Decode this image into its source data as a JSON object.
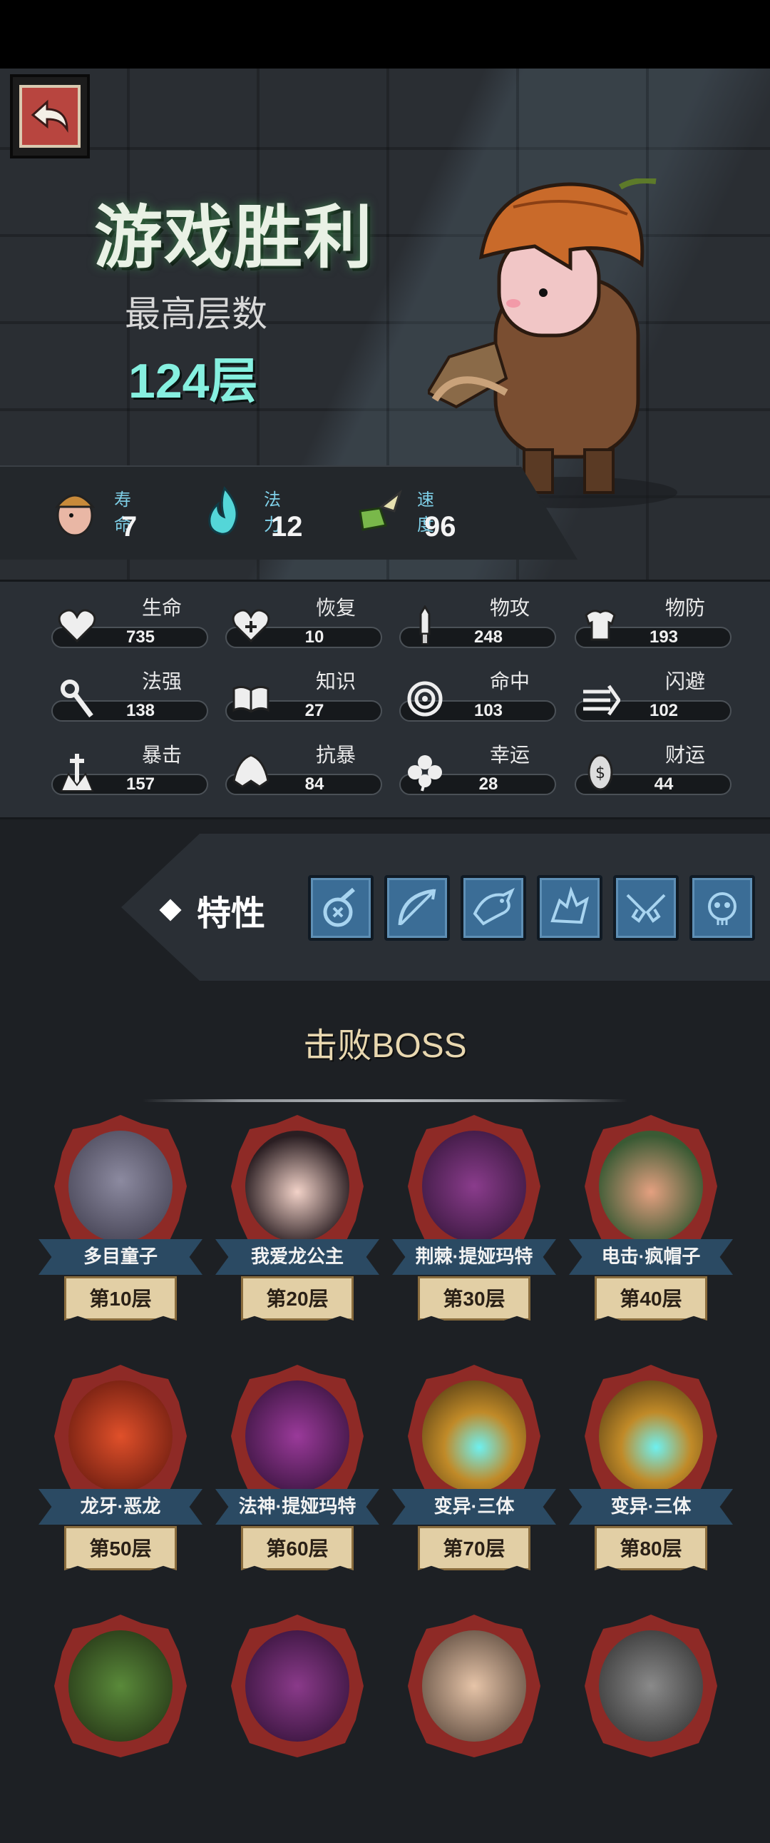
{
  "header": {
    "back_icon": "back-arrow-icon",
    "title": "游戏胜利",
    "best_floor_label": "最高层数",
    "best_floor_value": "124层"
  },
  "meta_stats": [
    {
      "label": "寿命",
      "value": "7",
      "icon": "hero-head-icon"
    },
    {
      "label": "法力",
      "value": "12",
      "icon": "blue-flame-icon"
    },
    {
      "label": "速度",
      "value": "96",
      "icon": "winged-boot-icon"
    }
  ],
  "stats": [
    {
      "label": "生命",
      "value": "735",
      "icon": "heart-icon"
    },
    {
      "label": "恢复",
      "value": "10",
      "icon": "heart-plus-icon"
    },
    {
      "label": "物攻",
      "value": "248",
      "icon": "sword-icon"
    },
    {
      "label": "物防",
      "value": "193",
      "icon": "armor-icon"
    },
    {
      "label": "法强",
      "value": "138",
      "icon": "staff-icon"
    },
    {
      "label": "知识",
      "value": "27",
      "icon": "book-icon"
    },
    {
      "label": "命中",
      "value": "103",
      "icon": "target-icon"
    },
    {
      "label": "闪避",
      "value": "102",
      "icon": "dodge-arrows-icon"
    },
    {
      "label": "暴击",
      "value": "157",
      "icon": "crit-dagger-icon"
    },
    {
      "label": "抗暴",
      "value": "84",
      "icon": "shield-shell-icon"
    },
    {
      "label": "幸运",
      "value": "28",
      "icon": "clover-icon"
    },
    {
      "label": "财运",
      "value": "44",
      "icon": "coin-icon"
    }
  ],
  "traits": {
    "label": "特性",
    "icons": [
      "poison-flask-icon",
      "crossbow-icon",
      "dragon-icon",
      "beast-icon",
      "twin-pistols-icon",
      "skull-icon"
    ]
  },
  "bosses": {
    "title": "击败BOSS",
    "items": [
      {
        "name": "多目童子",
        "floor": "第10层"
      },
      {
        "name": "我爱龙公主",
        "floor": "第20层"
      },
      {
        "name": "荆棘·提娅玛特",
        "floor": "第30层"
      },
      {
        "name": "电击·疯帽子",
        "floor": "第40层"
      },
      {
        "name": "龙牙·恶龙",
        "floor": "第50层"
      },
      {
        "name": "法神·提娅玛特",
        "floor": "第60层"
      },
      {
        "name": "变异·三体",
        "floor": "第70层"
      },
      {
        "name": "变异·三体",
        "floor": "第80层"
      }
    ]
  }
}
